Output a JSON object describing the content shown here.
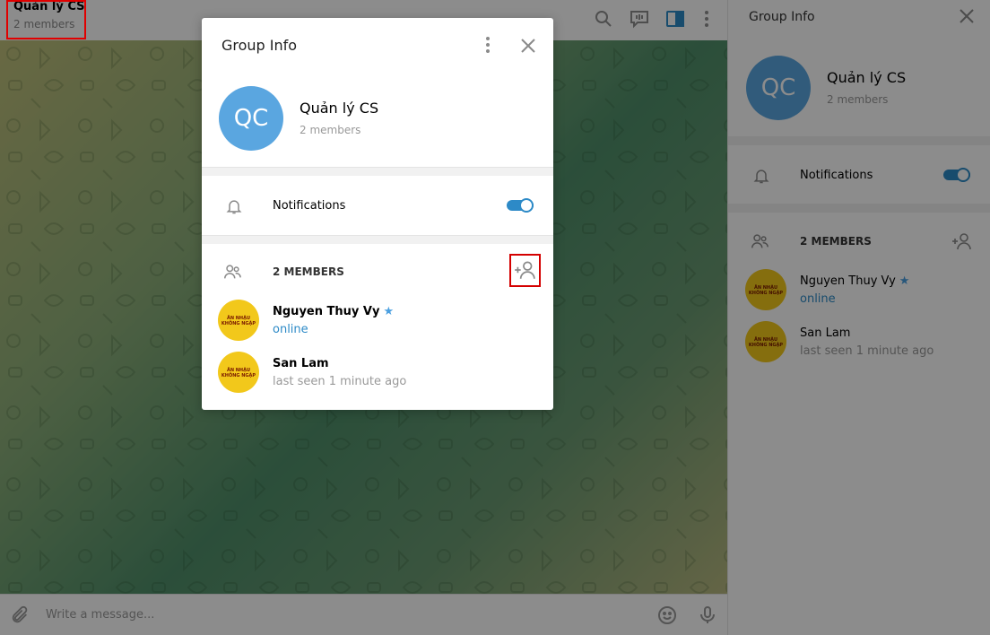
{
  "chat": {
    "title": "Quản lý CS",
    "subtitle": "2 members",
    "composer_placeholder": "Write a message..."
  },
  "modal": {
    "title": "Group Info",
    "avatar_initials": "QC",
    "group_name": "Quản lý CS",
    "group_sub": "2 members",
    "notifications_label": "Notifications",
    "notifications_on": true,
    "members_header": "2 MEMBERS",
    "members": [
      {
        "name": "Nguyen Thuy Vy",
        "status": "online",
        "starred": true,
        "avatar_text": "ĂN NHẬU KHÔNG NGẬP"
      },
      {
        "name": "San Lam",
        "status": "last seen 1 minute ago",
        "starred": false,
        "avatar_text": "ĂN NHẬU KHÔNG NGẬP"
      }
    ]
  },
  "panel": {
    "title": "Group Info",
    "avatar_initials": "QC",
    "group_name": "Quản lý CS",
    "group_sub": "2 members",
    "notifications_label": "Notifications",
    "notifications_on": true,
    "members_header": "2 MEMBERS",
    "members": [
      {
        "name": "Nguyen Thuy Vy",
        "status": "online",
        "starred": true
      },
      {
        "name": "San Lam",
        "status": "last seen 1 minute ago",
        "starred": false
      }
    ]
  },
  "colors": {
    "accent": "#2d8ac7",
    "avatar_group": "#5aa6e0",
    "avatar_member": "#f2c81b",
    "highlight_box": "#e00000"
  },
  "icons": [
    "search-icon",
    "comments-icon",
    "sidebar-toggle-icon",
    "more-vertical-icon",
    "close-icon",
    "bell-icon",
    "members-icon",
    "add-member-icon",
    "attach-icon",
    "emoji-icon",
    "microphone-icon",
    "star-icon"
  ]
}
